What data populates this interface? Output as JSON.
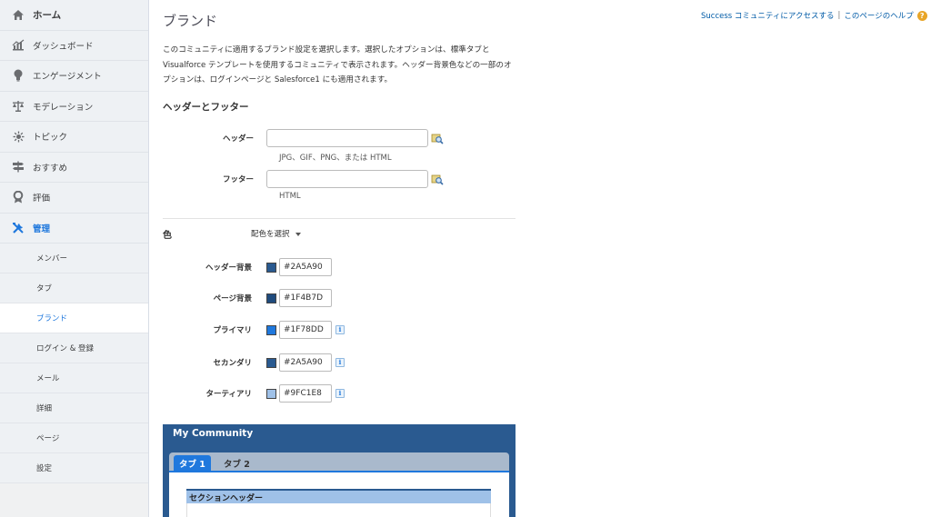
{
  "sidebar": {
    "items": [
      {
        "label": "ホーム",
        "icon": "home-icon"
      },
      {
        "label": "ダッシュボード",
        "icon": "dashboard-icon"
      },
      {
        "label": "エンゲージメント",
        "icon": "lightbulb-icon"
      },
      {
        "label": "モデレーション",
        "icon": "scale-icon"
      },
      {
        "label": "トピック",
        "icon": "topic-icon"
      },
      {
        "label": "おすすめ",
        "icon": "signpost-icon"
      },
      {
        "label": "評価",
        "icon": "award-icon"
      },
      {
        "label": "管理",
        "icon": "tools-icon"
      }
    ],
    "sub_items": [
      {
        "label": "メンバー"
      },
      {
        "label": "タブ"
      },
      {
        "label": "ブランド"
      },
      {
        "label": "ログイン & 登録"
      },
      {
        "label": "メール"
      },
      {
        "label": "詳細"
      },
      {
        "label": "ページ"
      },
      {
        "label": "設定"
      }
    ]
  },
  "header": {
    "title": "ブランド",
    "link_success": "Success コミュニティにアクセスする",
    "separator": "|",
    "link_help": "このページのヘルプ",
    "help_glyph": "?"
  },
  "description": "このコミュニティに適用するブランド設定を選択します。選択したオプションは、標準タブと Visualforce テンプレートを使用するコミュニティで表示されます。ヘッダー背景色などの一部のオプションは、ログインページと Salesforce1 にも適用されます。",
  "header_footer": {
    "section_title": "ヘッダーとフッター",
    "header_label": "ヘッダー",
    "header_hint": "JPG、GIF、PNG、または HTML",
    "footer_label": "フッター",
    "footer_hint": "HTML"
  },
  "colors": {
    "section_title": "色",
    "scheme_select": "配色を選択",
    "info_glyph": "i",
    "rows": [
      {
        "label": "ヘッダー背景",
        "value": "#2A5A90",
        "swatch": "#2A5A90",
        "info": false
      },
      {
        "label": "ページ背景",
        "value": "#1F4B7D",
        "swatch": "#1F4B7D",
        "info": false
      },
      {
        "label": "プライマリ",
        "value": "#1F78DD",
        "swatch": "#1F78DD",
        "info": true
      },
      {
        "label": "セカンダリ",
        "value": "#2A5A90",
        "swatch": "#2A5A90",
        "info": true
      },
      {
        "label": "ターティアリ",
        "value": "#9FC1E8",
        "swatch": "#9FC1E8",
        "info": true
      }
    ]
  },
  "preview": {
    "community_name": "My Community",
    "tab1": "タブ 1",
    "tab2": "タブ 2",
    "section_header": "セクションヘッダー"
  }
}
